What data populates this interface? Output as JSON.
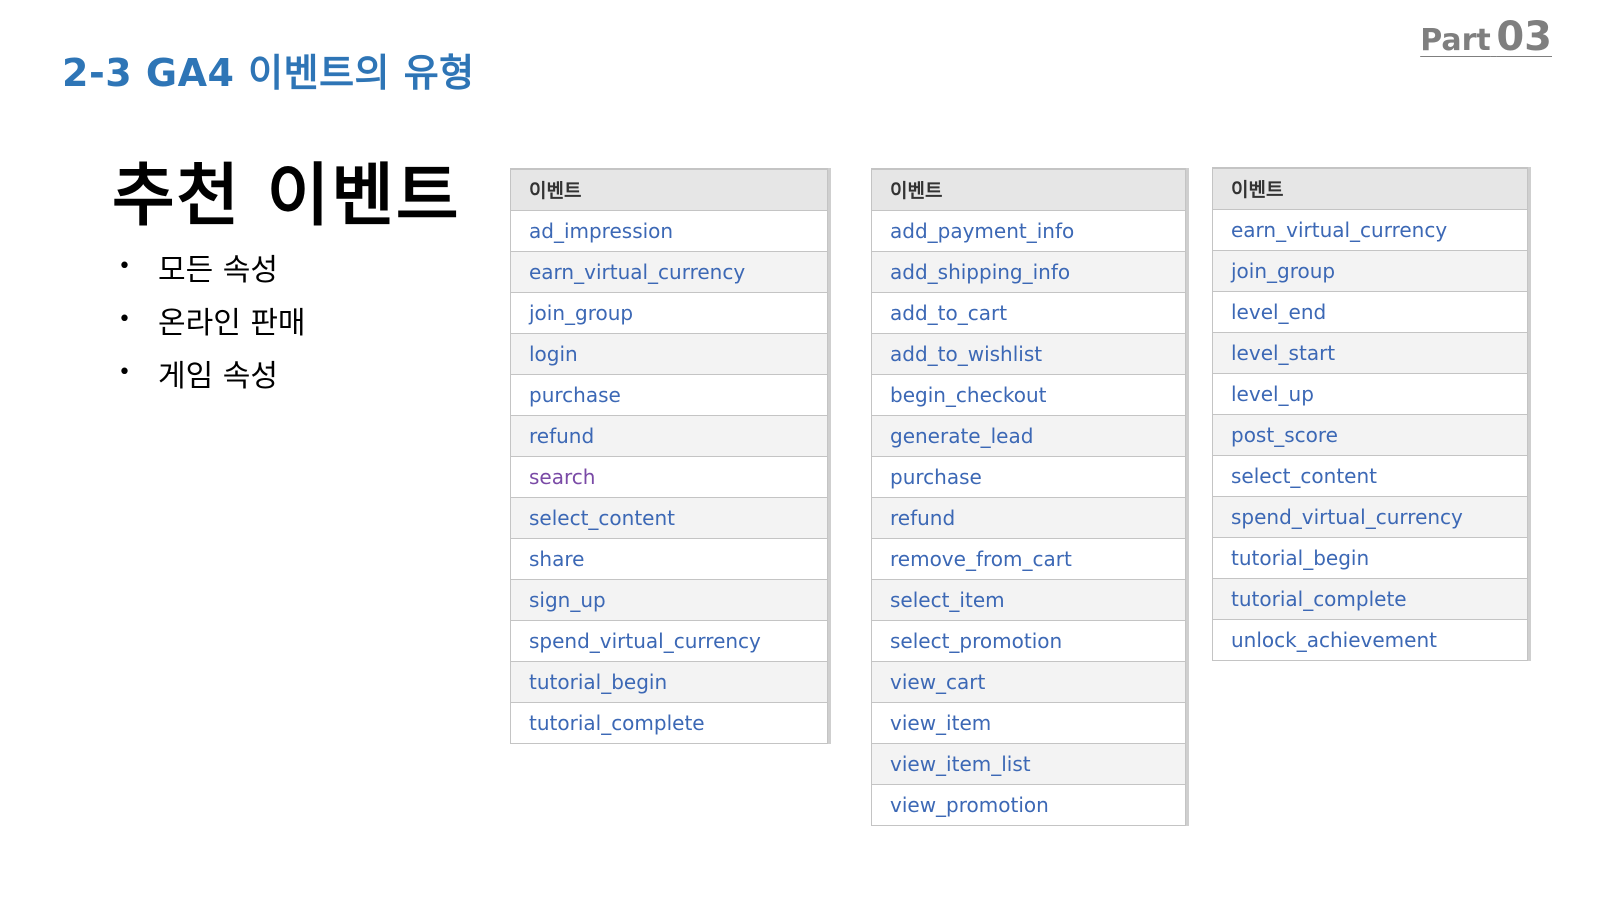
{
  "header": {
    "section_title": "2-3 GA4 이벤트의 유형",
    "part_word": "Part",
    "part_number": "03"
  },
  "main": {
    "heading": "추천 이벤트",
    "bullets": [
      "모든 속성",
      "온라인 판매",
      "게임 속성"
    ]
  },
  "tables": [
    {
      "header": "이벤트",
      "rows": [
        "ad_impression",
        "earn_virtual_currency",
        "join_group",
        "login",
        "purchase",
        "refund",
        "search",
        "select_content",
        "share",
        "sign_up",
        "spend_virtual_currency",
        "tutorial_begin",
        "tutorial_complete"
      ]
    },
    {
      "header": "이벤트",
      "rows": [
        "add_payment_info",
        "add_shipping_info",
        "add_to_cart",
        "add_to_wishlist",
        "begin_checkout",
        "generate_lead",
        "purchase",
        "refund",
        "remove_from_cart",
        "select_item",
        "select_promotion",
        "view_cart",
        "view_item",
        "view_item_list",
        "view_promotion"
      ]
    },
    {
      "header": "이벤트",
      "rows": [
        "earn_virtual_currency",
        "join_group",
        "level_end",
        "level_start",
        "level_up",
        "post_score",
        "select_content",
        "spend_virtual_currency",
        "tutorial_begin",
        "tutorial_complete",
        "unlock_achievement"
      ]
    }
  ],
  "colors": {
    "title_blue": "#2e75b6",
    "link_blue": "#3c68b5",
    "visited_purple": "#7a4aa6",
    "header_gray": "#e6e6e6"
  }
}
